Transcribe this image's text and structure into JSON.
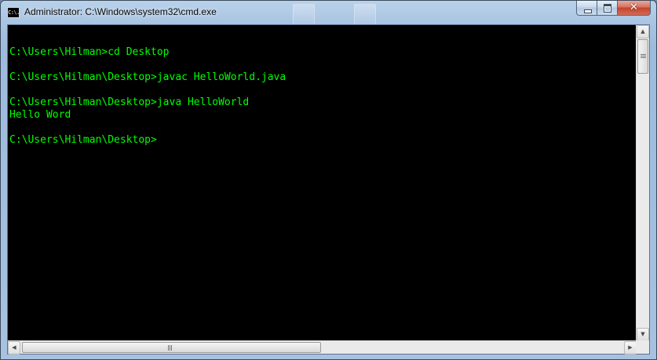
{
  "window": {
    "title": "Administrator: C:\\Windows\\system32\\cmd.exe",
    "icon": "cmd-icon",
    "icon_text": "C:\\."
  },
  "caption_buttons": {
    "minimize": "minimize-icon",
    "maximize": "maximize-icon",
    "close": "close-icon",
    "close_glyph": "✕"
  },
  "console": {
    "text_color": "#00ff00",
    "background": "#000000",
    "lines": [
      "",
      "C:\\Users\\Hilman>cd Desktop",
      "",
      "C:\\Users\\Hilman\\Desktop>javac HelloWorld.java",
      "",
      "C:\\Users\\Hilman\\Desktop>java HelloWorld",
      "Hello Word",
      "",
      "C:\\Users\\Hilman\\Desktop>"
    ]
  },
  "scrollbars": {
    "up_arrow": "▲",
    "down_arrow": "▼",
    "left_arrow": "◀",
    "right_arrow": "▶"
  }
}
